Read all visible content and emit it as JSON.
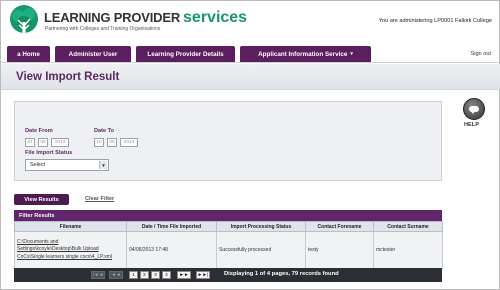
{
  "header": {
    "logo_title_a": "LEARNING PROVIDER",
    "logo_title_b": "services",
    "logo_tagline": "Partnering with Colleges and Training Organisations",
    "admin_text": "You are administering LP0001 Falkirk College"
  },
  "nav": {
    "tabs": [
      {
        "label": "a Home"
      },
      {
        "label": "Administer User"
      },
      {
        "label": "Learning Provider Details"
      },
      {
        "label": "Applicant Information Service",
        "caret": "▾"
      }
    ],
    "sign_out": "Sign out"
  },
  "page": {
    "title": "View Import Result"
  },
  "help": {
    "label": "HELP"
  },
  "search": {
    "date_from_label": "Date From",
    "date_from": {
      "day": "01",
      "month": "05",
      "year": "2013"
    },
    "date_to_label": "Date To",
    "date_to": {
      "day": "10",
      "month": "06",
      "year": "2013"
    },
    "status_label": "File Import Status",
    "status_selected": "Select"
  },
  "buttons": {
    "view_results": "View Results",
    "clear_filter": "Clear Filter"
  },
  "results": {
    "header": "Filter Results",
    "columns": [
      "Filename",
      "Date / Time File Imported",
      "Import Processing Status",
      "Contact Forename",
      "Contact Surname"
    ],
    "rows": [
      {
        "filename": "C:\\Documents and Settings\\kcoyle\\Desktop\\Bulk Upload CoCs\\Single learners single cocs\\4_LP.xml",
        "imported": "04/06/2013 17:48",
        "status": "Successfully processed",
        "forename": "testy",
        "surname": "mctester"
      }
    ]
  },
  "pager": {
    "first": "|◄◄",
    "prev": "◄◄",
    "pages": [
      "1",
      "2",
      "3",
      "4"
    ],
    "next": "►►",
    "last": "►►|",
    "info": "Displaying 1 of 4 pages, 79 records found"
  },
  "colors": {
    "brand_purple": "#5b1f5f",
    "brand_green": "#17966e",
    "pager_bg": "#2b2f34"
  }
}
